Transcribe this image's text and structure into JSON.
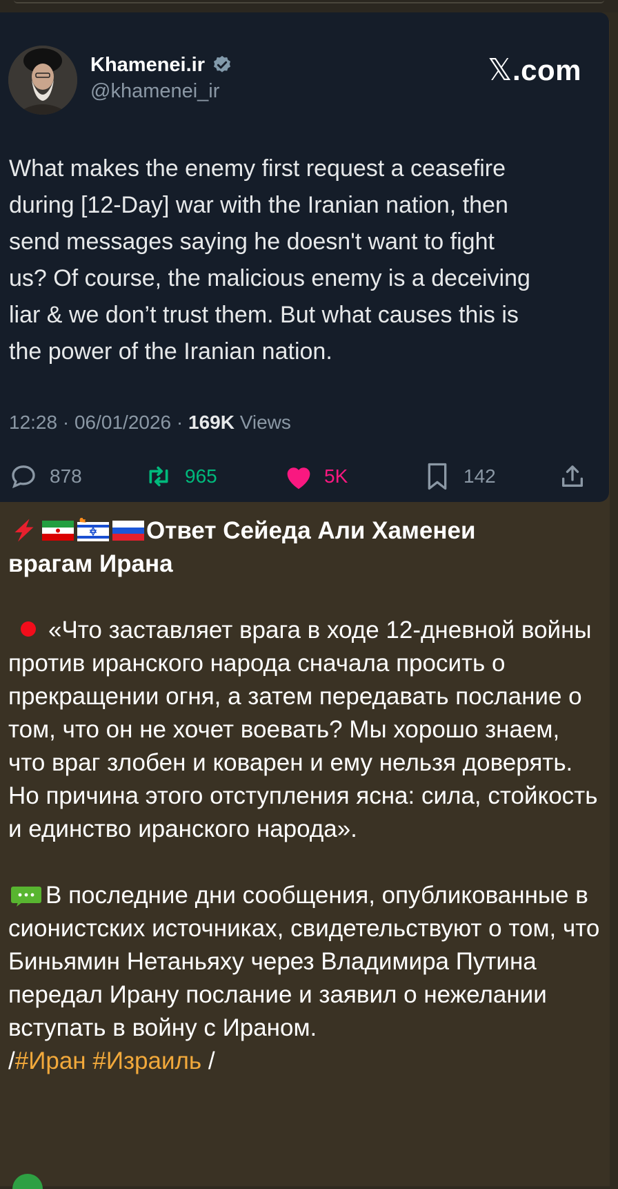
{
  "tweet": {
    "name": "Khamenei.ir",
    "handle": "@khamenei_ir",
    "brand_x": "𝕏",
    "brand_suffix": ".com",
    "text": "What makes the enemy first request a ceasefire\nduring [12-Day] war with the Iranian nation, then\nsend messages saying he doesn't want to fight\nus? Of course, the malicious enemy is a deceiving\nliar & we don’t trust them. But what causes this is\nthe power of the Iranian nation.",
    "time": "12:28",
    "date": "06/01/2026",
    "separator": "·",
    "views_count": "169K",
    "views_label": "Views",
    "replies": "878",
    "reposts": "965",
    "likes": "5K",
    "bookmarks": "142",
    "colors": {
      "background": "#151d29",
      "repost": "#00ba7c",
      "like": "#f91880",
      "muted": "#8b98a5",
      "verified": "#829aab"
    },
    "icons": [
      "verified-badge-icon",
      "reply-icon",
      "repost-icon",
      "like-heart-icon",
      "bookmark-icon",
      "share-icon"
    ]
  },
  "message": {
    "headline_emoji": "⚡",
    "flags": [
      "iran-flag",
      "israel-flag-burning",
      "russia-flag"
    ],
    "headline_line1": "Ответ Сейеда Али Хаменеи",
    "headline_line2": "врагам Ирана",
    "quote": "«Что заставляет врага в ходе 12-дневной войны против иранского народа сначала просить о прекращении огня, а затем передавать послание о том, что он не хочет воевать? Мы хорошо знаем, что враг злобен и коварен и ему нельзя доверять. Но причина этого отступления ясна: сила, стойкость и единство иранского народа».",
    "note": "В последние дни сообщения, опубликованные в сионистских источниках, свидетельствуют о том, что Биньямин Нетаньяху через Владимира Путина передал Ирану послание и заявил о нежелании вступать в войну с Ираном.",
    "slash_open": "/",
    "hashtag_1": "#Иран",
    "hashtag_2": "#Израиль",
    "slash_close": "/",
    "colors": {
      "bubble": "#3a3224",
      "hashtag": "#f2a93b",
      "red_dot": "#f20d1b"
    }
  }
}
